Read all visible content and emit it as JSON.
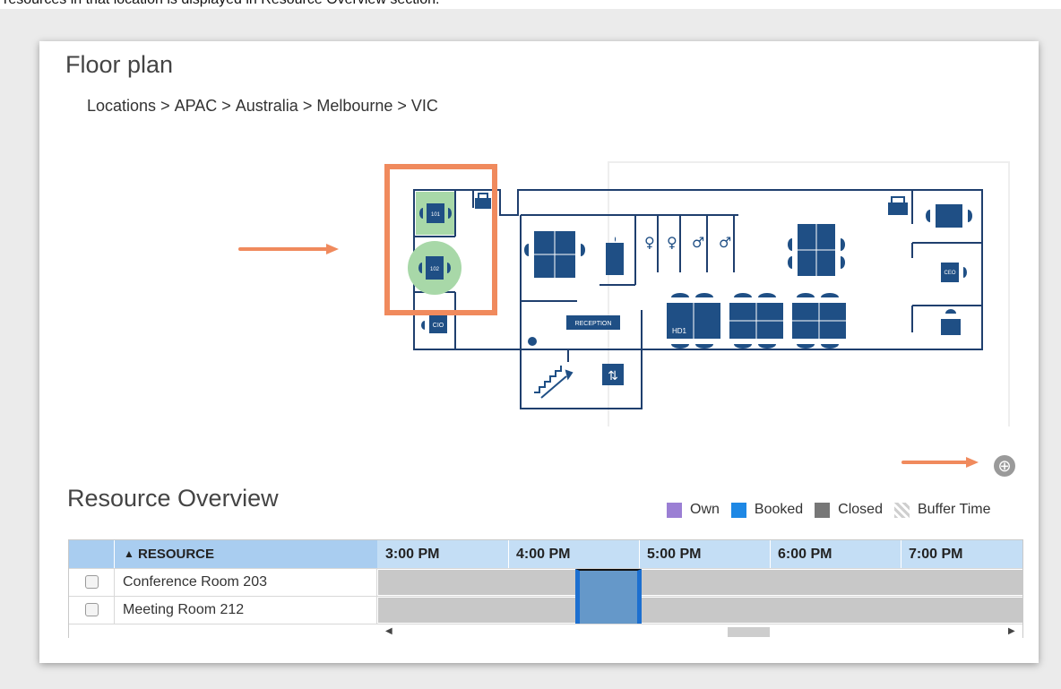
{
  "caption_fragment": "resources in that location is displayed in Resource Overview section.",
  "page_title": "Floor plan",
  "breadcrumb": [
    "Locations",
    "APAC",
    "Australia",
    "Melbourne",
    "VIC"
  ],
  "breadcrumb_separator": ">",
  "floorplan": {
    "desks": [
      "101",
      "102"
    ],
    "rooms": [
      "CIO",
      "RECEPTION",
      "HD1",
      "CEO"
    ],
    "highlight_color": "#f08a5d",
    "selected_color": "#a8d8a8"
  },
  "resource_overview": {
    "title": "Resource Overview",
    "legend": [
      {
        "label": "Own",
        "color": "#9b7fd4"
      },
      {
        "label": "Booked",
        "color": "#1e88e5"
      },
      {
        "label": "Closed",
        "color": "#777777"
      },
      {
        "label": "Buffer Time",
        "color": "#d5d5d5"
      }
    ],
    "columns": {
      "resource": "RESOURCE",
      "sort_indicator": "▲",
      "times": [
        "3:00 PM",
        "4:00 PM",
        "5:00 PM",
        "6:00 PM",
        "7:00 PM"
      ]
    },
    "rows": [
      {
        "name": "Conference Room 203"
      },
      {
        "name": "Meeting Room 212"
      }
    ]
  },
  "icons": {
    "zoom": "zoom-in-icon",
    "scroll_left": "◀",
    "scroll_right": "▶"
  }
}
